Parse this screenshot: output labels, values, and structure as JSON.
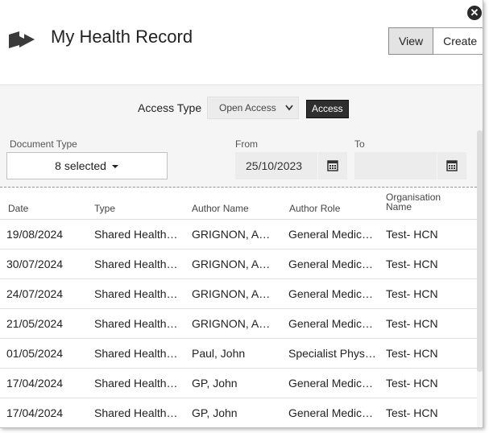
{
  "app": {
    "title": "My Health Record"
  },
  "toolbar": {
    "view_label": "View",
    "create_label": "Create",
    "close_glyph": "✕"
  },
  "access": {
    "label": "Access Type",
    "selected": "Open Access",
    "button": "Access"
  },
  "filters": {
    "document_type_label": "Document Type",
    "document_type_value": "8 selected",
    "from_label": "From",
    "from_value": "25/10/2023",
    "to_label": "To",
    "to_value": ""
  },
  "table": {
    "columns": [
      "Date",
      "Type",
      "Author Name",
      "Author Role",
      "Organisation Name"
    ],
    "rows": [
      [
        "19/08/2024",
        "Shared Health …",
        "GRIGNON, ADR…",
        "General Medic…",
        "Test- HCN"
      ],
      [
        "30/07/2024",
        "Shared Health …",
        "GRIGNON, ADR…",
        "General Medic…",
        "Test- HCN"
      ],
      [
        "24/07/2024",
        "Shared Health …",
        "GRIGNON, ADR…",
        "General Medic…",
        "Test- HCN"
      ],
      [
        "21/05/2024",
        "Shared Health …",
        "GRIGNON, ADR…",
        "General Medic…",
        "Test- HCN"
      ],
      [
        "01/05/2024",
        "Shared Health …",
        "Paul, John",
        "Specialist Phys…",
        "Test- HCN"
      ],
      [
        "17/04/2024",
        "Shared Health …",
        "GP, John",
        "General Medic…",
        "Test- HCN"
      ],
      [
        "17/04/2024",
        "Shared Health …",
        "GP, John",
        "General Medic…",
        "Test- HCN"
      ]
    ]
  },
  "icons": {
    "logo": "record-logo-icon",
    "calendar": "calendar-icon",
    "close": "close-icon",
    "caret": "caret-down-icon"
  }
}
